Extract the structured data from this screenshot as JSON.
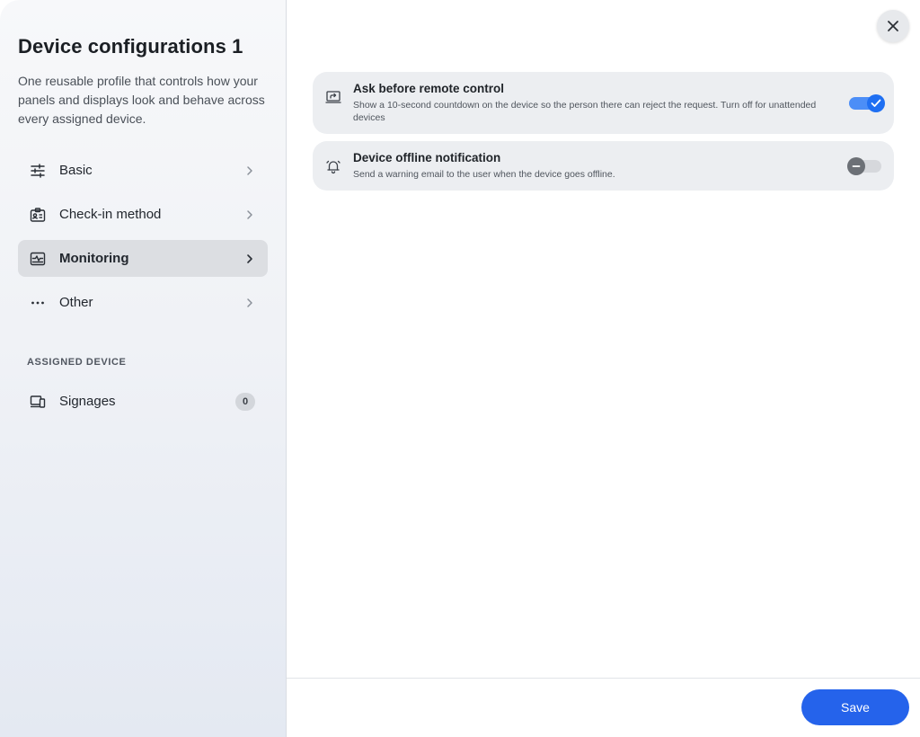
{
  "sidebar": {
    "title": "Device configurations 1",
    "description": "One reusable profile that controls how your panels and displays look and behave across every assigned device.",
    "items": [
      {
        "label": "Basic",
        "icon": "sliders-icon"
      },
      {
        "label": "Check-in method",
        "icon": "id-badge-icon"
      },
      {
        "label": "Monitoring",
        "icon": "monitoring-icon",
        "active": true
      },
      {
        "label": "Other",
        "icon": "more-dots-icon"
      }
    ],
    "section_label": "ASSIGNED DEVICE",
    "assigned": {
      "label": "Signages",
      "count": "0",
      "icon": "devices-icon"
    }
  },
  "main": {
    "settings": [
      {
        "title": "Ask before remote control",
        "description": "Show a 10-second countdown on the device so the person there can reject the request. Turn off for unattended devices",
        "enabled": true,
        "icon": "remote-screen-icon"
      },
      {
        "title": "Device offline notification",
        "description": "Send a warning email to the user when the device goes offline.",
        "enabled": false,
        "icon": "bell-icon"
      }
    ]
  },
  "footer": {
    "save_label": "Save"
  },
  "colors": {
    "accent": "#2563eb",
    "toggle_on": "#4c8ef7",
    "toggle_off": "#d6d8dc"
  }
}
